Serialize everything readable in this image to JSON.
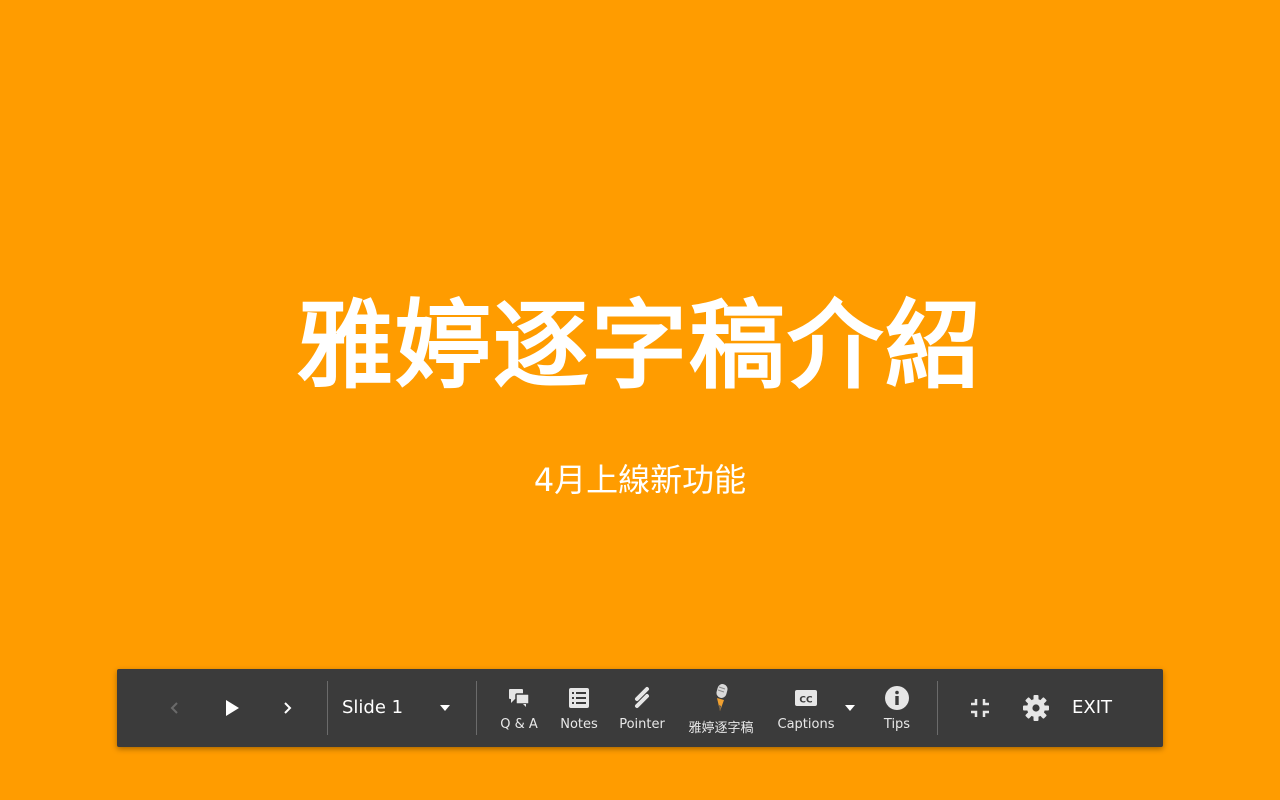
{
  "slide": {
    "title": "雅婷逐字稿介紹",
    "subtitle": "4月上線新功能",
    "background": "#FF9C00"
  },
  "toolbar": {
    "prev_icon": "chevron-left-icon",
    "play_icon": "play-icon",
    "next_icon": "chevron-right-icon",
    "slide_selector": {
      "value": "Slide 1",
      "icon": "dropdown-arrow-icon"
    },
    "tools": [
      {
        "label": "Q & A",
        "icon": "qa-chat-icon"
      },
      {
        "label": "Notes",
        "icon": "notes-icon"
      },
      {
        "label": "Pointer",
        "icon": "laser-pointer-icon"
      },
      {
        "label": "雅婷逐字稿",
        "icon": "microphone-pen-icon"
      },
      {
        "label": "Captions",
        "icon": "cc-icon"
      },
      {
        "label": "Tips",
        "icon": "info-icon"
      }
    ],
    "exit_fullscreen_icon": "exit-fullscreen-icon",
    "settings_icon": "gear-icon",
    "exit_label": "EXIT"
  }
}
